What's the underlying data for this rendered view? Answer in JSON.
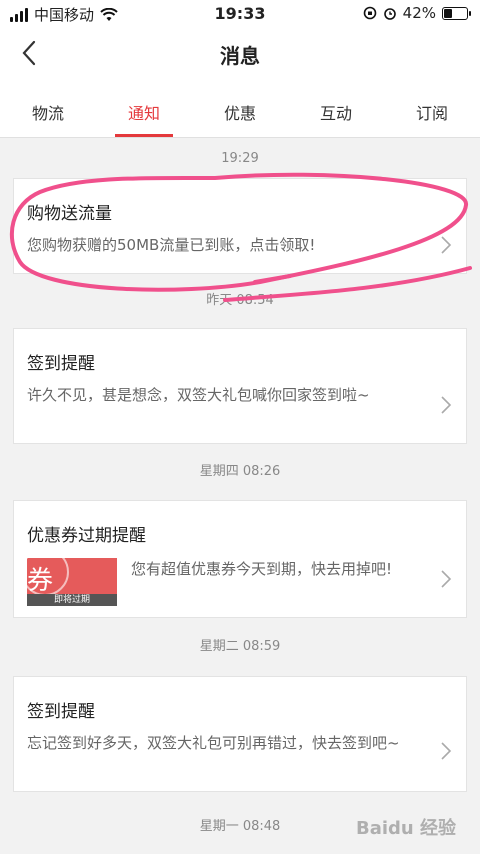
{
  "status_bar": {
    "carrier": "中国移动",
    "time": "19:33",
    "battery_percent_text": "42%",
    "battery_level": 0.42
  },
  "nav": {
    "title": "消息",
    "back_icon": "chevron-left-icon"
  },
  "tabs": [
    {
      "label": "物流",
      "active": false
    },
    {
      "label": "通知",
      "active": true
    },
    {
      "label": "优惠",
      "active": false
    },
    {
      "label": "互动",
      "active": false
    },
    {
      "label": "订阅",
      "active": false
    }
  ],
  "messages": [
    {
      "time": "19:29",
      "title": "购物送流量",
      "body": "您购物获赠的50MB流量已到账，点击领取!"
    },
    {
      "time": "昨天 08:54",
      "title": "签到提醒",
      "body": "许久不见，甚是想念，双签大礼包喊你回家签到啦~"
    },
    {
      "time": "星期四 08:26",
      "title": "优惠券过期提醒",
      "body": "您有超值优惠券今天到期，快去用掉吧!",
      "coupon_char": "券",
      "coupon_caption": "即将过期"
    },
    {
      "time": "星期二 08:59",
      "title": "签到提醒",
      "body": "忘记签到好多天，双签大礼包可别再错过，快去签到吧~"
    },
    {
      "time": "星期一 08:48"
    }
  ],
  "watermark": "Baidu 经验",
  "colors": {
    "accent": "#e4393c",
    "annotation": "#f0508c"
  }
}
